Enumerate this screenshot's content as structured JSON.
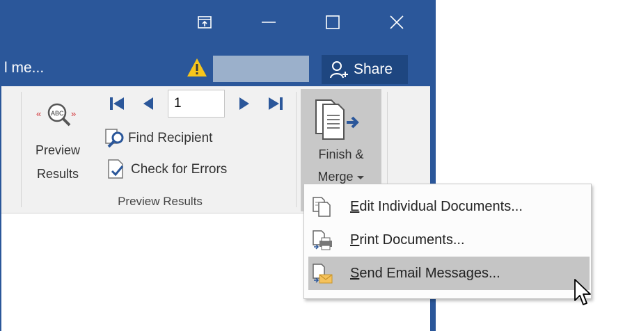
{
  "titlebar": {
    "ribbon_display_label": "Ribbon Display Options",
    "minimize_label": "Minimize",
    "maximize_label": "Maximize",
    "close_label": "Close"
  },
  "tellbar": {
    "tell_me_text": "l me...",
    "share_label": "Share"
  },
  "preview_group": {
    "preview_results_button": [
      "Preview",
      "Results"
    ],
    "record_number": "1",
    "find_recipient_label": "Find Recipient",
    "check_errors_label": "Check for Errors",
    "group_label": "Preview Results"
  },
  "finish_group": {
    "finish_merge_label": [
      "Finish &",
      "Merge"
    ]
  },
  "finish_menu": {
    "items": [
      {
        "label": "Edit Individual Documents...",
        "accel": "E",
        "rest": "dit Individual Documents..."
      },
      {
        "label": "Print Documents...",
        "accel": "P",
        "rest": "rint Documents..."
      },
      {
        "label": "Send Email Messages...",
        "accel": "S",
        "rest": "end Email Messages..."
      }
    ],
    "highlighted_index": 2
  },
  "colors": {
    "title_blue": "#2b579a",
    "share_bg": "#1e4680",
    "ribbon_bg": "#f1f1f1",
    "menu_highlight": "#c5c5c5",
    "nav_blue": "#2b579a"
  }
}
